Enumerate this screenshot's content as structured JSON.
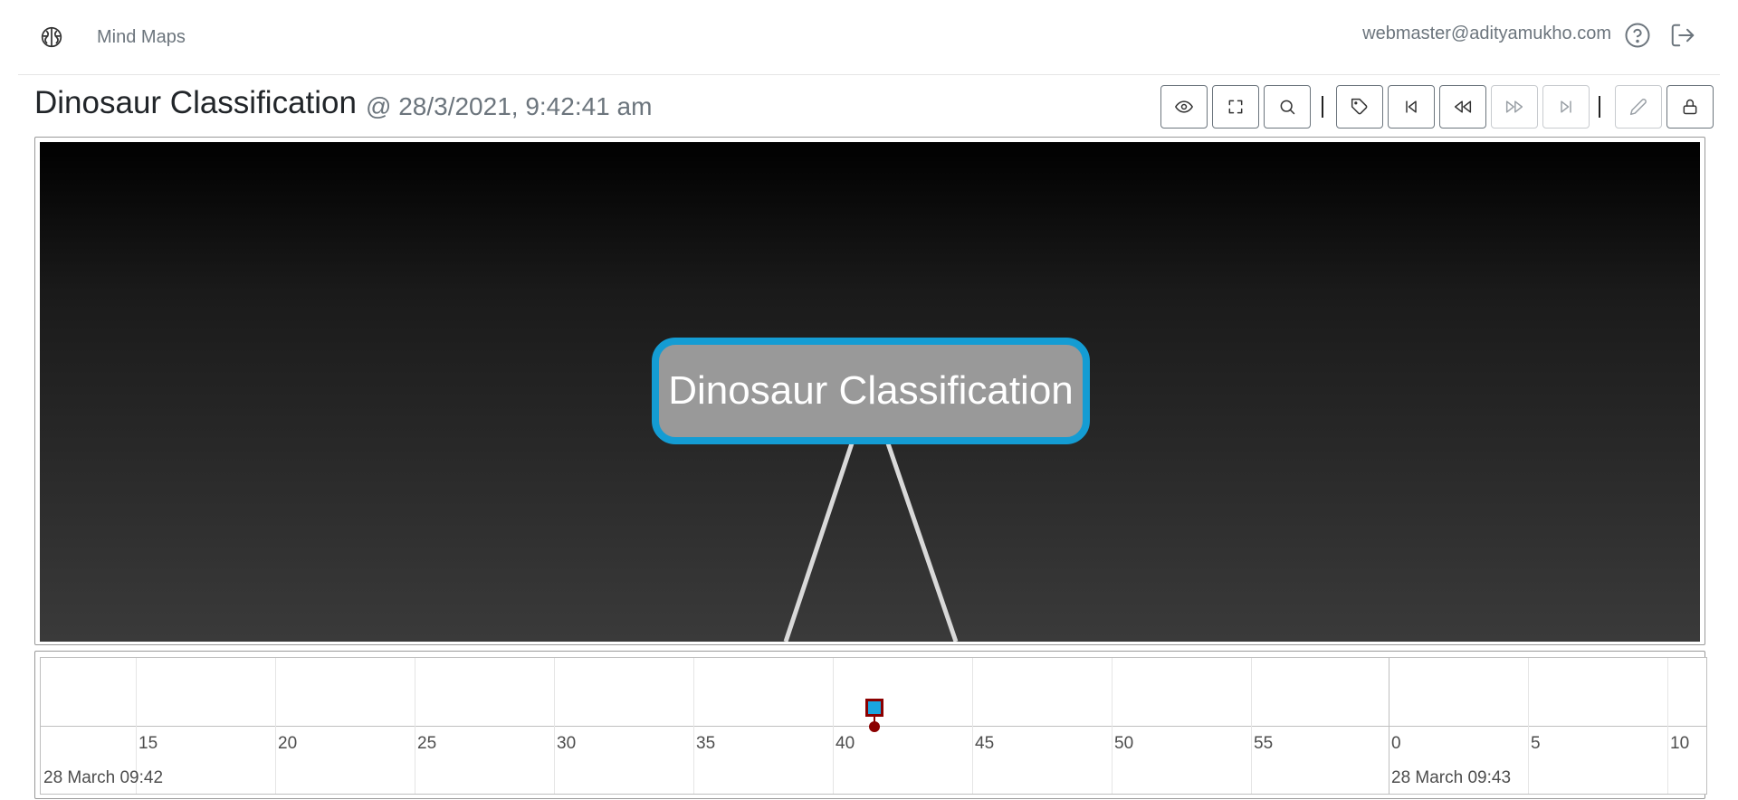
{
  "navbar": {
    "brand_icon": "brain-icon",
    "brand_label": "Mind Maps",
    "user_email": "webmaster@adityamukho.com",
    "help_icon": "help-circle-icon",
    "logout_icon": "logout-icon"
  },
  "page": {
    "title": "Dinosaur Classification",
    "timestamp": "@ 28/3/2021, 9:42:41 am"
  },
  "toolbar": {
    "buttons": [
      {
        "name": "show-button",
        "icon": "eye-icon",
        "enabled": true
      },
      {
        "name": "fit-button",
        "icon": "fullscreen-icon",
        "enabled": true
      },
      {
        "name": "search-button",
        "icon": "search-icon",
        "enabled": true
      },
      {
        "name": "tag-button",
        "icon": "tag-icon",
        "enabled": true
      },
      {
        "name": "first-button",
        "icon": "skip-back-icon",
        "enabled": true
      },
      {
        "name": "previous-button",
        "icon": "rewind-icon",
        "enabled": true
      },
      {
        "name": "next-button",
        "icon": "fast-forward-icon",
        "enabled": false
      },
      {
        "name": "last-button",
        "icon": "skip-forward-icon",
        "enabled": false
      },
      {
        "name": "edit-button",
        "icon": "edit-icon",
        "enabled": false
      },
      {
        "name": "lock-button",
        "icon": "lock-icon",
        "enabled": true
      }
    ]
  },
  "canvas": {
    "root_node_label": "Dinosaur Classification",
    "node_border_color": "#149cd3",
    "node_fill_color": "#999999",
    "edge_color": "#d9d9d9"
  },
  "timeline": {
    "minor_ticks": [
      "15",
      "20",
      "25",
      "30",
      "35",
      "40",
      "45",
      "50",
      "55",
      "0",
      "5",
      "10"
    ],
    "major_labels": [
      "28 March 09:42",
      "28 March 09:43"
    ],
    "event_color": "#1aa5e0",
    "event_border_color": "#8b0000"
  }
}
